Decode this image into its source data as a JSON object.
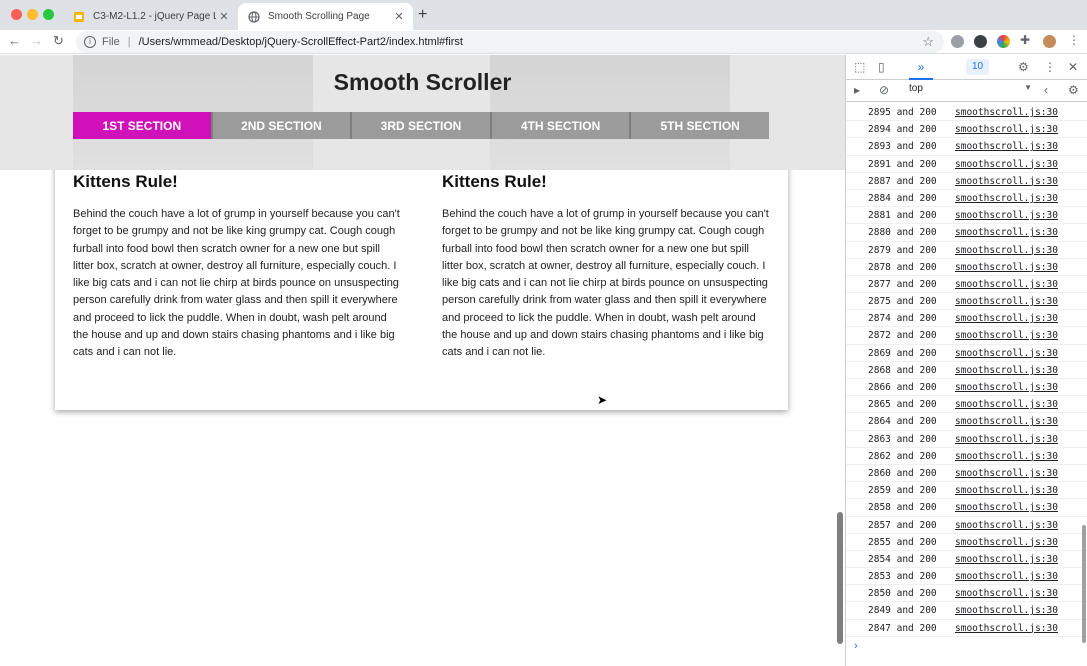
{
  "browser": {
    "tabs": [
      {
        "title": "C3-M2-L1.2 - jQuery Page Lo...",
        "close": "✕"
      },
      {
        "title": "Smooth Scrolling Page",
        "close": "✕"
      }
    ],
    "new_tab": "+",
    "nav": {
      "back": "←",
      "forward": "→",
      "reload": "↻"
    },
    "address": {
      "scheme_label": "File",
      "url": "/Users/wmmead/Desktop/jQuery-ScrollEffect-Part2/index.html#first"
    },
    "colors": {
      "tabbar": "#dee1e6",
      "accent": "#1a73e8"
    }
  },
  "page": {
    "title": "Smooth Scroller",
    "nav": [
      {
        "label": "1ST SECTION",
        "active": true
      },
      {
        "label": "2ND SECTION",
        "active": false
      },
      {
        "label": "3RD SECTION",
        "active": false
      },
      {
        "label": "4TH SECTION",
        "active": false
      },
      {
        "label": "5TH SECTION",
        "active": false
      }
    ],
    "active_color": "#d010b9",
    "columns": [
      {
        "heading": "Kittens Rule!",
        "body": "Behind the couch have a lot of grump in yourself because you can't forget to be grumpy and not be like king grumpy cat. Cough cough furball into food bowl then scratch owner for a new one but spill litter box, scratch at owner, destroy all furniture, especially couch. I like big cats and i can not lie chirp at birds pounce on unsuspecting person carefully drink from water glass and then spill it everywhere and proceed to lick the puddle. When in doubt, wash pelt around the house and up and down stairs chasing phantoms and i like big cats and i can not lie."
      },
      {
        "heading": "Kittens Rule!",
        "body": "Behind the couch have a lot of grump in yourself because you can't forget to be grumpy and not be like king grumpy cat. Cough cough furball into food bowl then scratch owner for a new one but spill litter box, scratch at owner, destroy all furniture, especially couch. I like big cats and i can not lie chirp at birds pounce on unsuspecting person carefully drink from water glass and then spill it everywhere and proceed to lick the puddle. When in doubt, wash pelt around the house and up and down stairs chasing phantoms and i like big cats and i can not lie."
      }
    ]
  },
  "devtools": {
    "tab_label": "»",
    "message_count": "10",
    "context": "top",
    "log_source": "smoothscroll.js:30",
    "logs": [
      "2895 and 200",
      "2894 and 200",
      "2893 and 200",
      "2891 and 200",
      "2887 and 200",
      "2884 and 200",
      "2881 and 200",
      "2880 and 200",
      "2879 and 200",
      "2878 and 200",
      "2877 and 200",
      "2875 and 200",
      "2874 and 200",
      "2872 and 200",
      "2869 and 200",
      "2868 and 200",
      "2866 and 200",
      "2865 and 200",
      "2864 and 200",
      "2863 and 200",
      "2862 and 200",
      "2860 and 200",
      "2859 and 200",
      "2858 and 200",
      "2857 and 200",
      "2855 and 200",
      "2854 and 200",
      "2853 and 200",
      "2850 and 200",
      "2849 and 200",
      "2847 and 200"
    ],
    "prompt": "›"
  }
}
